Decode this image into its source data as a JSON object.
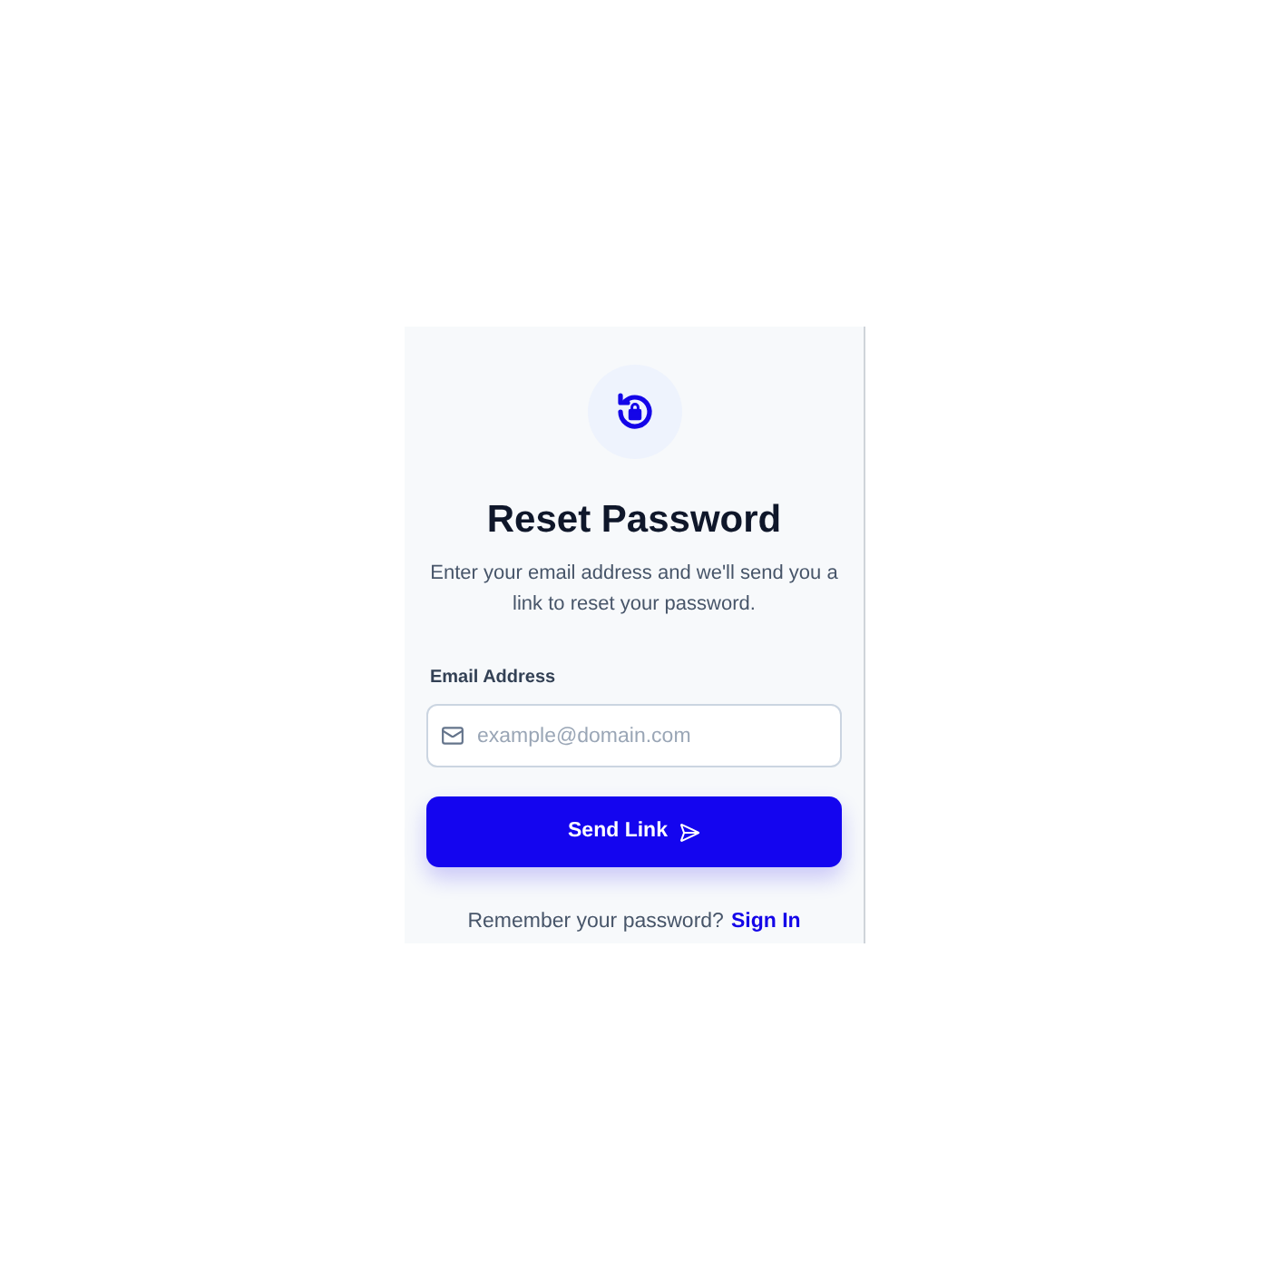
{
  "title": "Reset Password",
  "description": "Enter your email address and we'll send you a link to reset your password.",
  "email_field": {
    "label": "Email Address",
    "placeholder": "example@domain.com"
  },
  "submit_button": {
    "label": "Send Link"
  },
  "footer": {
    "text": "Remember your password?",
    "link": "Sign In"
  }
}
